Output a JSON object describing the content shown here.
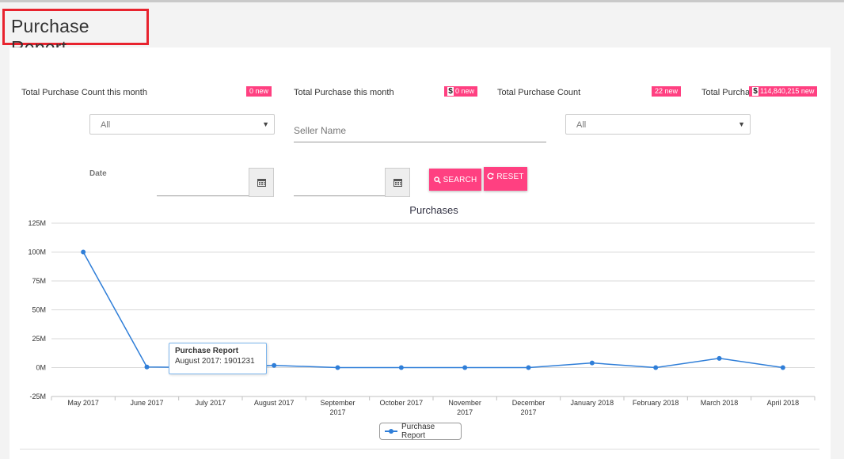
{
  "page": {
    "title": "Purchase Report"
  },
  "stats": [
    {
      "label": "Total Purchase Count this month",
      "badge": "0 new",
      "currency": false
    },
    {
      "label": "Total Purchase this month",
      "badge": "0 new",
      "currency": true
    },
    {
      "label": "Total Purchase Count",
      "badge": "22 new",
      "currency": false
    },
    {
      "label": "Total Purcha",
      "badge": "114,840,215 new",
      "currency": true
    }
  ],
  "filters": {
    "select1": {
      "value": "All"
    },
    "seller": {
      "placeholder": "Seller Name"
    },
    "select2": {
      "value": "All"
    },
    "date_label": "Date",
    "search_label": "SEARCH",
    "reset_label": "RESET"
  },
  "colors": {
    "accent": "#ff4081",
    "series": "#2f7ed8",
    "title_box": "#e8232e"
  },
  "icons": {
    "calendar": "calendar-icon",
    "search": "search-icon",
    "reset": "refresh-icon",
    "caret": "chevron-down-icon"
  },
  "tooltip": {
    "title": "Purchase Report",
    "text": "August 2017: 1901231"
  },
  "chart_data": {
    "type": "line",
    "title": "Purchases",
    "categories": [
      "May 2017",
      "June 2017",
      "July 2017",
      "August 2017",
      "September 2017",
      "October 2017",
      "November 2017",
      "December 2017",
      "January 2018",
      "February 2018",
      "March 2018",
      "April 2018"
    ],
    "category_lines": [
      [
        "May 2017"
      ],
      [
        "June 2017"
      ],
      [
        "July 2017"
      ],
      [
        "August 2017"
      ],
      [
        "September",
        "2017"
      ],
      [
        "October 2017"
      ],
      [
        "November",
        "2017"
      ],
      [
        "December",
        "2017"
      ],
      [
        "January 2018"
      ],
      [
        "February 2018"
      ],
      [
        "March 2018"
      ],
      [
        "April 2018"
      ]
    ],
    "series": [
      {
        "name": "Purchase Report",
        "values": [
          100000000,
          500000,
          0,
          1901231,
          0,
          0,
          0,
          0,
          4000000,
          0,
          8000000,
          0
        ]
      }
    ],
    "y_ticks": [
      "-25M",
      "0M",
      "25M",
      "50M",
      "75M",
      "100M",
      "125M"
    ],
    "ylim": [
      -25000000,
      125000000
    ],
    "grid": true,
    "legend": "bottom-center"
  }
}
